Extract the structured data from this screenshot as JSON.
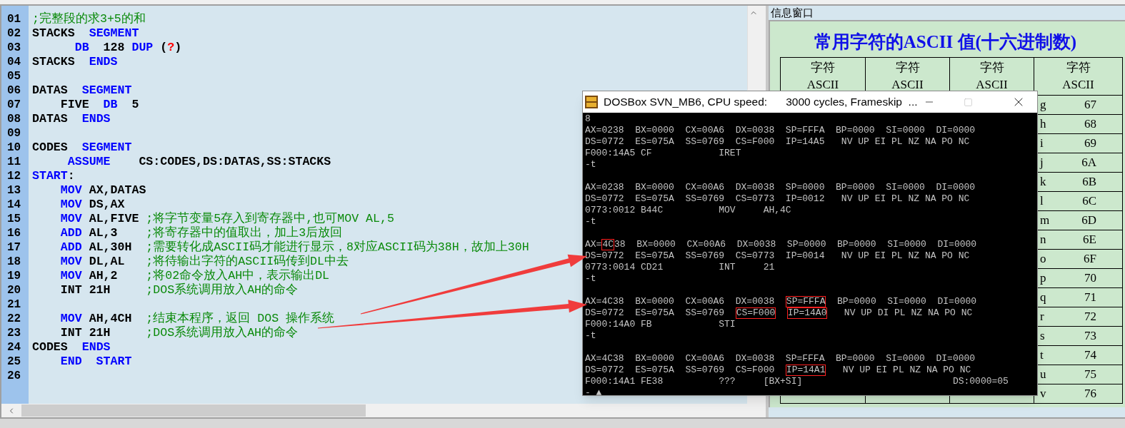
{
  "editor": {
    "lines": [
      {
        "number": "01",
        "segments": [
          {
            "kind": "comment",
            "text": ";完整段的求3+5的和"
          }
        ]
      },
      {
        "number": "02",
        "segments": [
          {
            "kind": "plain",
            "text": "STACKS  "
          },
          {
            "kind": "keyword",
            "text": "SEGMENT"
          }
        ]
      },
      {
        "number": "03",
        "segments": [
          {
            "kind": "keyword",
            "text": "      DB"
          },
          {
            "kind": "plain",
            "text": "  128 "
          },
          {
            "kind": "keyword",
            "text": "DUP"
          },
          {
            "kind": "plain",
            "text": " ("
          },
          {
            "kind": "error",
            "text": "?"
          },
          {
            "kind": "plain",
            "text": ")"
          }
        ]
      },
      {
        "number": "04",
        "segments": [
          {
            "kind": "plain",
            "text": "STACKS  "
          },
          {
            "kind": "keyword",
            "text": "ENDS"
          }
        ]
      },
      {
        "number": "05"
      },
      {
        "number": "06",
        "segments": [
          {
            "kind": "plain",
            "text": "DATAS  "
          },
          {
            "kind": "keyword",
            "text": "SEGMENT"
          }
        ]
      },
      {
        "number": "07",
        "segments": [
          {
            "kind": "plain",
            "text": "    FIVE  "
          },
          {
            "kind": "keyword",
            "text": "DB"
          },
          {
            "kind": "plain",
            "text": "  5"
          }
        ]
      },
      {
        "number": "08",
        "segments": [
          {
            "kind": "plain",
            "text": "DATAS  "
          },
          {
            "kind": "keyword",
            "text": "ENDS"
          }
        ]
      },
      {
        "number": "09"
      },
      {
        "number": "10",
        "segments": [
          {
            "kind": "plain",
            "text": "CODES  "
          },
          {
            "kind": "keyword",
            "text": "SEGMENT"
          }
        ]
      },
      {
        "number": "11",
        "segments": [
          {
            "kind": "keyword",
            "text": "     ASSUME"
          },
          {
            "kind": "plain",
            "text": "    CS:CODES,DS:DATAS,SS:STACKS"
          }
        ]
      },
      {
        "number": "12",
        "segments": [
          {
            "kind": "keyword",
            "text": "START"
          },
          {
            "kind": "plain",
            "text": ":"
          }
        ]
      },
      {
        "number": "13",
        "segments": [
          {
            "kind": "keyword",
            "text": "    MOV"
          },
          {
            "kind": "plain",
            "text": " AX,DATAS"
          }
        ]
      },
      {
        "number": "14",
        "segments": [
          {
            "kind": "keyword",
            "text": "    MOV"
          },
          {
            "kind": "plain",
            "text": " DS,AX"
          }
        ]
      },
      {
        "number": "15",
        "segments": [
          {
            "kind": "keyword",
            "text": "    MOV"
          },
          {
            "kind": "plain",
            "text": " AL,FIVE "
          },
          {
            "kind": "comment",
            "text": ";将字节变量5存入到寄存器中,也可MOV AL,5"
          }
        ]
      },
      {
        "number": "16",
        "segments": [
          {
            "kind": "keyword",
            "text": "    ADD"
          },
          {
            "kind": "plain",
            "text": " AL,3    "
          },
          {
            "kind": "comment",
            "text": ";将寄存器中的值取出，加上3后放回"
          }
        ]
      },
      {
        "number": "17",
        "segments": [
          {
            "kind": "keyword",
            "text": "    ADD"
          },
          {
            "kind": "plain",
            "text": " AL,30H  "
          },
          {
            "kind": "comment",
            "text": ";需要转化成ASCII码才能进行显示，8对应ASCII码为38H，故加上30H"
          }
        ]
      },
      {
        "number": "18",
        "segments": [
          {
            "kind": "keyword",
            "text": "    MOV"
          },
          {
            "kind": "plain",
            "text": " DL,AL   "
          },
          {
            "kind": "comment",
            "text": ";将待输出字符的ASCII码传到DL中去"
          }
        ]
      },
      {
        "number": "19",
        "segments": [
          {
            "kind": "keyword",
            "text": "    MOV"
          },
          {
            "kind": "plain",
            "text": " AH,2    "
          },
          {
            "kind": "comment",
            "text": ";将02命令放入AH中，表示输出DL"
          }
        ]
      },
      {
        "number": "20",
        "segments": [
          {
            "kind": "plain",
            "text": "    INT 21H     "
          },
          {
            "kind": "comment",
            "text": ";DOS系统调用放入AH的命令"
          }
        ]
      },
      {
        "number": "21"
      },
      {
        "number": "22",
        "segments": [
          {
            "kind": "keyword",
            "text": "    MOV"
          },
          {
            "kind": "plain",
            "text": " AH,4CH  "
          },
          {
            "kind": "comment",
            "text": ";结束本程序，返回 DOS 操作系统"
          }
        ]
      },
      {
        "number": "23",
        "segments": [
          {
            "kind": "plain",
            "text": "    INT 21H     "
          },
          {
            "kind": "comment",
            "text": ";DOS系统调用放入AH的命令"
          }
        ]
      },
      {
        "number": "24",
        "segments": [
          {
            "kind": "plain",
            "text": "CODES  "
          },
          {
            "kind": "keyword",
            "text": "ENDS"
          }
        ]
      },
      {
        "number": "25",
        "segments": [
          {
            "kind": "keyword",
            "text": "    END  START"
          }
        ]
      },
      {
        "number": "26"
      }
    ]
  },
  "info_window": {
    "title": "信息窗口",
    "heading": "常用字符的ASCII 值(十六进制数)",
    "table": {
      "columns": [
        {
          "label": "字符",
          "sublabel": "ASCII"
        },
        {
          "label": "字符",
          "sublabel": "ASCII"
        },
        {
          "label": "字符",
          "sublabel": "ASCII"
        },
        {
          "label": "字符",
          "sublabel": "ASCII"
        }
      ],
      "rows": [
        {
          "char": "g",
          "code": "67"
        },
        {
          "char": "h",
          "code": "68"
        },
        {
          "char": "i",
          "code": "69"
        },
        {
          "char": "j",
          "code": "6A"
        },
        {
          "char": "k",
          "code": "6B"
        },
        {
          "char": "l",
          "code": "6C"
        },
        {
          "char": "m",
          "code": "6D"
        },
        {
          "char": "n",
          "code": "6E"
        },
        {
          "char": "o",
          "code": "6F"
        },
        {
          "char": "p",
          "code": "70"
        },
        {
          "char": "q",
          "code": "71"
        },
        {
          "char": "r",
          "code": "72"
        },
        {
          "char": "s",
          "code": "73"
        },
        {
          "char": "t",
          "code": "74"
        },
        {
          "char": "u",
          "code": "75"
        },
        {
          "char": "v",
          "code": "76"
        }
      ]
    }
  },
  "dosbox": {
    "title": "DOSBox SVN_MB6, CPU speed:",
    "status": "3000 cycles, Frameskip  ...",
    "lines": [
      {
        "segments": [
          {
            "text": "8"
          }
        ]
      },
      {
        "segments": [
          {
            "text": "AX=0238  BX=0000  CX=00A6  DX=0038  SP=FFFA  BP=0000  SI=0000  DI=0000"
          }
        ]
      },
      {
        "segments": [
          {
            "text": "DS=0772  ES=075A  SS=0769  CS=F000  IP=14A5   NV UP EI PL NZ NA PO NC"
          }
        ]
      },
      {
        "segments": [
          {
            "text": "F000:14A5 CF            IRET"
          }
        ]
      },
      {
        "segments": [
          {
            "text": "-t"
          }
        ]
      },
      {
        "spaced": true,
        "segments": [
          {
            "text": "AX=0238  BX=0000  CX=00A6  DX=0038  SP=0000  BP=0000  SI=0000  DI=0000"
          }
        ]
      },
      {
        "segments": [
          {
            "text": "DS=0772  ES=075A  SS=0769  CS=0773  IP=0012   NV UP EI PL NZ NA PO NC"
          }
        ]
      },
      {
        "segments": [
          {
            "text": "0773:0012 B44C          MOV     AH,4C"
          }
        ]
      },
      {
        "segments": [
          {
            "text": "-t"
          }
        ]
      },
      {
        "spaced": true,
        "segments": [
          {
            "text": "AX="
          },
          {
            "text": "4C",
            "highlighted": true
          },
          {
            "text": "38  BX=0000  CX=00A6  DX=0038  SP=0000  BP=0000  SI=0000  DI=0000"
          }
        ]
      },
      {
        "segments": [
          {
            "text": "DS=0772  ES=075A  SS=0769  CS=0773  IP=0014   NV UP EI PL NZ NA PO NC"
          }
        ]
      },
      {
        "segments": [
          {
            "text": "0773:0014 CD21          INT     21"
          }
        ]
      },
      {
        "segments": [
          {
            "text": "-t"
          }
        ]
      },
      {
        "spaced": true,
        "segments": [
          {
            "text": "AX=4C38  BX=0000  CX=00A6  DX=0038  "
          },
          {
            "text": "SP=FFFA",
            "highlighted": true
          },
          {
            "text": "  BP=0000  SI=0000  DI=0000"
          }
        ]
      },
      {
        "segments": [
          {
            "text": "DS=0772  ES=075A  SS=0769  "
          },
          {
            "text": "CS=F000",
            "highlighted": true
          },
          {
            "text": "IP=14A0",
            "highlighted": true
          },
          {
            "text": "   NV UP DI PL NZ NA PO NC"
          }
        ]
      },
      {
        "segments": [
          {
            "text": "F000:14A0 FB            STI"
          }
        ]
      },
      {
        "segments": [
          {
            "text": "-t"
          }
        ]
      },
      {
        "spaced": true,
        "segments": [
          {
            "text": "AX=4C38  BX=0000  CX=00A6  DX=0038  SP=FFFA  BP=0000  SI=0000  DI=0000"
          }
        ]
      },
      {
        "segments": [
          {
            "text": "DS=0772  ES=075A  SS=0769  CS=F000  "
          },
          {
            "text": "IP=14A1",
            "highlighted": true
          },
          {
            "text": "   NV UP EI PL NZ NA PO NC"
          }
        ]
      },
      {
        "segments": [
          {
            "text": "F000:14A1 FE38          ???     [BX+SI]                           DS:0000=05"
          }
        ]
      },
      {
        "segments": [
          {
            "text": "- ▲"
          }
        ]
      }
    ]
  }
}
